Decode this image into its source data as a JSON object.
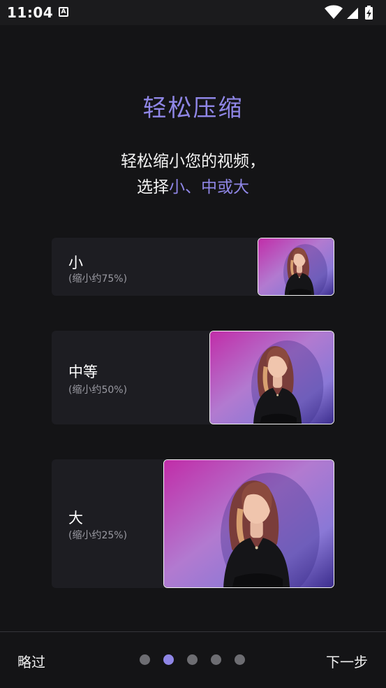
{
  "status_bar": {
    "time": "11:04",
    "notification_icon": "a-icon",
    "icons": [
      "wifi-icon",
      "signal-icon",
      "battery-charging-icon"
    ]
  },
  "header": {
    "title": "轻松压缩",
    "subtitle_line1": "轻松缩小您的视频，",
    "subtitle_line2_prefix": "选择",
    "subtitle_line2_options": "小、中或大"
  },
  "options": [
    {
      "label": "小",
      "hint": "(缩小约75%)"
    },
    {
      "label": "中等",
      "hint": "(缩小约50%)"
    },
    {
      "label": "大",
      "hint": "(缩小约25%)"
    }
  ],
  "footer": {
    "skip_label": "略过",
    "next_label": "下一步",
    "page_count": 5,
    "current_page": 2
  },
  "colors": {
    "accent": "#8f86e6",
    "background": "#141416",
    "card": "#1d1d22"
  }
}
